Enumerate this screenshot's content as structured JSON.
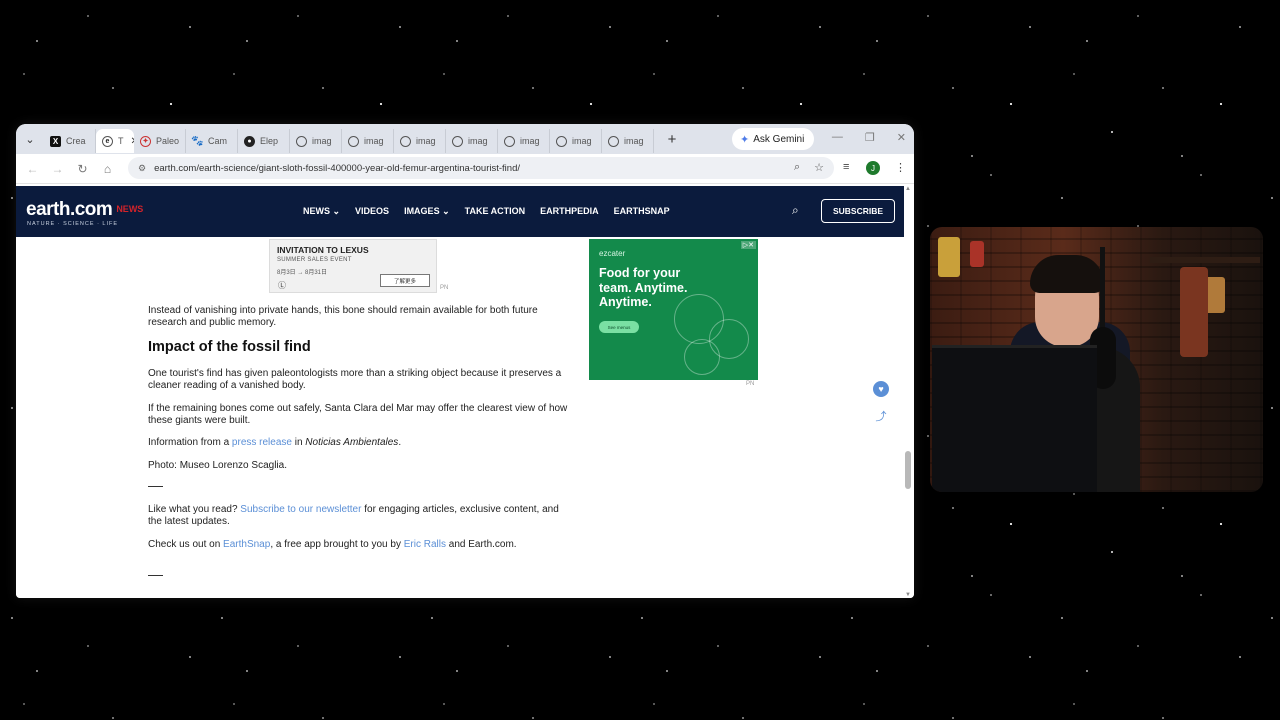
{
  "browser": {
    "tabs": [
      {
        "label": "Crea",
        "icon": "x-logo-icon"
      },
      {
        "label": "T",
        "icon": "earth-com-icon",
        "active": true
      },
      {
        "label": "Paleo",
        "icon": "paleo-icon"
      },
      {
        "label": "Cam",
        "icon": "paw-icon"
      },
      {
        "label": "Elep",
        "icon": "leaf-icon"
      },
      {
        "label": "imag",
        "icon": "globe-icon"
      },
      {
        "label": "imag",
        "icon": "globe-icon"
      },
      {
        "label": "imag",
        "icon": "globe-icon"
      },
      {
        "label": "imag",
        "icon": "globe-icon"
      },
      {
        "label": "imag",
        "icon": "globe-icon"
      },
      {
        "label": "imag",
        "icon": "globe-icon"
      },
      {
        "label": "imag",
        "icon": "globe-icon"
      }
    ],
    "new_tab_label": "+",
    "gemini_label": "Ask Gemini",
    "url": "earth.com/earth-science/giant-sloth-fossil-400000-year-old-femur-argentina-tourist-find/",
    "profile_initial": "J"
  },
  "site": {
    "logo": "earth.com",
    "logo_news": "NEWS",
    "logo_tagline": "NATURE · SCIENCE · LIFE",
    "nav": [
      "NEWS ⌄",
      "VIDEOS",
      "IMAGES ⌄",
      "TAKE ACTION",
      "EARTHPEDIA",
      "EARTHSNAP"
    ],
    "subscribe": "SUBSCRIBE"
  },
  "ads": {
    "lexus": {
      "title": "INVITATION TO LEXUS",
      "subtitle": "SUMMER SALES EVENT",
      "date": "8月3日 → 8月31日",
      "button": "了解更多",
      "pn": "PN"
    },
    "ezcater": {
      "brand": "ezcater",
      "headline": "Food for your team. Anytime. Anytime.",
      "headline_lines": [
        "Food for your",
        "team. Anytime.",
        "Anytime."
      ],
      "button": "See menus",
      "pn": "PN",
      "adchoice": "▷✕"
    }
  },
  "article": {
    "p1": "Instead of vanishing into private hands, this bone should remain available for both future research and public memory.",
    "heading": "Impact of the fossil find",
    "p2": "One tourist's find has given paleontologists more than a striking object because it preserves a cleaner reading of a vanished body.",
    "p3": "If the remaining bones come out safely, Santa Clara del Mar may offer the clearest view of how these giants were built.",
    "p4_pre": "Information from a ",
    "p4_link": "press release",
    "p4_mid": " in ",
    "p4_em": "Noticias Ambientales",
    "p4_post": ".",
    "p5": "Photo: Museo Lorenzo Scaglia.",
    "p6_pre": "Like what you read? ",
    "p6_link": "Subscribe to our newsletter",
    "p6_post": " for engaging articles, exclusive content, and the latest updates.",
    "p7_pre": "Check us out on ",
    "p7_link1": "EarthSnap",
    "p7_mid": ", a free app brought to you by ",
    "p7_link2": "Eric Ralls",
    "p7_post": " and Earth.com."
  },
  "colors": {
    "nav_bg": "#0b1b3d",
    "link": "#5b8fd6",
    "ezcater_green": "#138a4b",
    "news_red": "#d2232a"
  }
}
